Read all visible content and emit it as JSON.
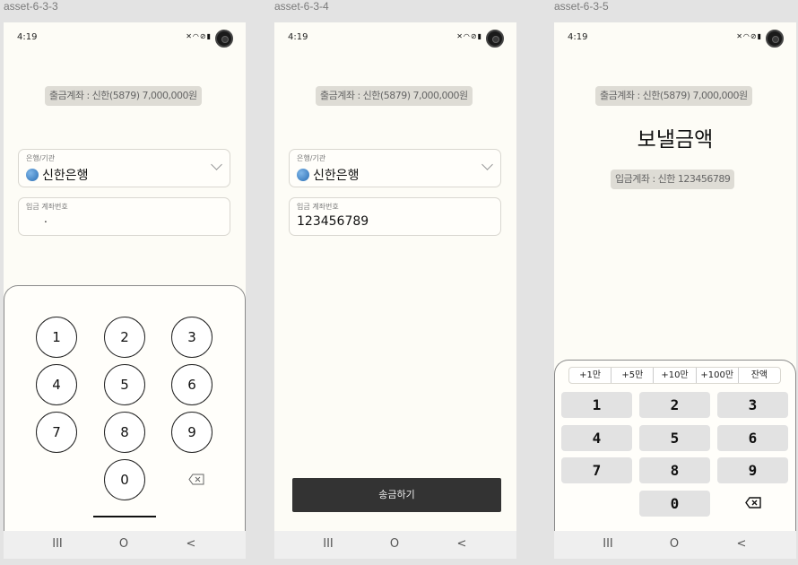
{
  "frames": [
    {
      "label": "asset-6-3-3"
    },
    {
      "label": "asset-6-3-4"
    },
    {
      "label": "asset-6-3-5"
    }
  ],
  "status": {
    "time": "4:19",
    "icons": [
      "mute-icon",
      "wifi-icon",
      "no-disturb-icon",
      "battery-icon",
      "camera-icon"
    ]
  },
  "account": {
    "source_text": "출금계좌 : 신한(5879) 7,000,000원",
    "dest_text": "입금계좌 : 신한 123456789"
  },
  "bank_field": {
    "label": "은행/기관",
    "value": "신한은행",
    "icon": "bank-globe-icon"
  },
  "account_field": {
    "label": "입금 계좌번호",
    "value_empty": ".",
    "value_filled": "123456789"
  },
  "numpad": {
    "keys": [
      "1",
      "2",
      "3",
      "4",
      "5",
      "6",
      "7",
      "8",
      "9",
      "0"
    ],
    "backspace_icon": "backspace-icon"
  },
  "submit_label": "송금하기",
  "amount_title": "보낼금액",
  "quick_amounts": [
    "+1만",
    "+5만",
    "+10만",
    "+100만",
    "잔액"
  ],
  "navbar": {
    "recent": "III",
    "home": "O",
    "back": "<"
  }
}
